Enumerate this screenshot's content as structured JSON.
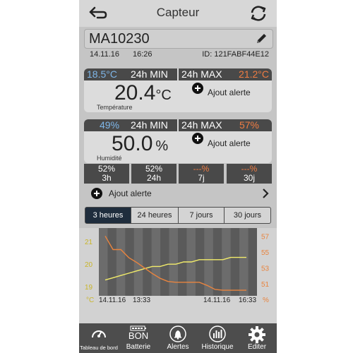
{
  "header": {
    "title": "Capteur",
    "back_icon": "back-arrow-icon",
    "refresh_icon": "refresh-icon"
  },
  "device": {
    "name": "MA10230",
    "date": "14.11.16",
    "time": "16:26",
    "id": "ID: 121FABF44E12",
    "edit_icon": "pencil-icon"
  },
  "temperature": {
    "min_value": "18.5°C",
    "min_label": "24h MIN",
    "max_label": "24h MAX",
    "max_value": "21.2°C",
    "current": "20.4",
    "unit": "°C",
    "caption": "Température",
    "alert_label": "Ajout alerte"
  },
  "humidity": {
    "min_value": "49%",
    "min_label": "24h MIN",
    "max_label": "24h MAX",
    "max_value": "57%",
    "current": "50.0",
    "unit": "%",
    "caption": "Humidité",
    "alert_label": "Ajout alerte",
    "stats": [
      {
        "value": "52%",
        "period": "3h"
      },
      {
        "value": "52%",
        "period": "24h"
      },
      {
        "value": "---%",
        "period": "7j"
      },
      {
        "value": "---%",
        "period": "30j"
      }
    ]
  },
  "alert_row": {
    "label": "Ajout alerte"
  },
  "range_tabs": [
    {
      "label": "3 heures",
      "active": true
    },
    {
      "label": "24 heures",
      "active": false
    },
    {
      "label": "7 jours",
      "active": false
    },
    {
      "label": "30 jours",
      "active": false
    }
  ],
  "chart_data": {
    "type": "line",
    "left_axis_ticks": [
      "21",
      "20",
      "19"
    ],
    "right_axis_ticks": [
      "57",
      "55",
      "53",
      "51"
    ],
    "left_unit": "°C",
    "right_unit": "%",
    "x_labels": [
      {
        "date": "14.11.16",
        "time": "13:33"
      },
      {
        "date": "14.11.16",
        "time": "16:33"
      }
    ],
    "ylim_left": [
      18.6,
      21.6
    ],
    "ylim_right": [
      49.5,
      58.0
    ],
    "series": [
      {
        "axis": "left",
        "color": "#f2ec6a",
        "values": [
          19.3,
          19.4,
          19.5,
          19.6,
          19.7,
          19.8,
          19.9,
          19.9,
          20.0,
          20.0,
          20.1,
          20.1,
          20.2,
          20.2,
          20.2,
          20.2,
          20.3,
          20.3,
          20.3
        ]
      },
      {
        "axis": "right",
        "color": "#e8843f",
        "values": [
          57.0,
          55.3,
          55.3,
          54.3,
          53.7,
          53.0,
          52.3,
          51.7,
          51.3,
          51.2,
          51.2,
          51.2,
          51.2,
          50.8,
          50.3,
          50.2,
          50.2,
          50.2,
          50.2
        ]
      }
    ]
  },
  "nav": [
    {
      "label": "Tableau de bord",
      "icon": "dashboard-gauge-icon"
    },
    {
      "label": "Batterie",
      "icon": "battery-icon",
      "badge": "BON"
    },
    {
      "label": "Alertes",
      "icon": "bell-icon"
    },
    {
      "label": "Historique",
      "icon": "history-chart-icon"
    },
    {
      "label": "Editer",
      "icon": "gear-icon"
    }
  ]
}
